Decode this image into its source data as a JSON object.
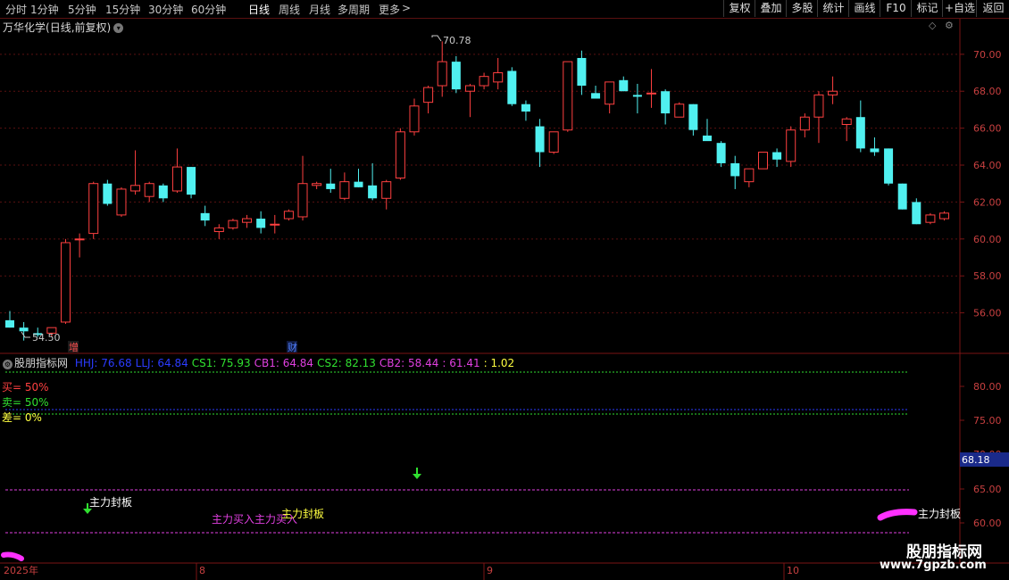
{
  "toolbar": {
    "periods": [
      "分时",
      "1分钟",
      "5分钟",
      "15分钟",
      "30分钟",
      "60分钟",
      "日线",
      "周线",
      "月线",
      "多周期",
      "更多"
    ],
    "active_period": "日线",
    "more_arrow": ">",
    "buttons": [
      "复权",
      "叠加",
      "多股",
      "统计",
      "画线",
      "F10",
      "标记",
      "+自选",
      "返回"
    ]
  },
  "stock": {
    "name": "万华化学",
    "period_label": "(日线,前复权)"
  },
  "price_axis": {
    "ticks": [
      "70.00",
      "68.00",
      "66.00",
      "64.00",
      "62.00",
      "60.00",
      "58.00",
      "56.00"
    ],
    "min": 54.0,
    "max": 71.2
  },
  "annotations": {
    "high_label": "70.78",
    "low_label": "54.50",
    "marker_zeng": "增",
    "marker_cai": "财"
  },
  "indicator": {
    "name": "股朋指标网",
    "values": [
      {
        "label": "HHJ: 76.68",
        "color": "#2b3cff"
      },
      {
        "label": "LLJ: 64.84",
        "color": "#2b3cff"
      },
      {
        "label": "CS1: 75.93",
        "color": "#30e030"
      },
      {
        "label": "CB1: 64.84",
        "color": "#e040e0"
      },
      {
        "label": "CS2: 82.13",
        "color": "#30e030"
      },
      {
        "label": "CB2: 58.44",
        "color": "#e040e0"
      },
      {
        "label": ": 61.41",
        "color": "#e040e0"
      },
      {
        "label": ": 1.02",
        "color": "#ffff40"
      }
    ],
    "buy_label": "买= 50%",
    "sell_label": "卖= 50%",
    "diff_label": "差= 0%",
    "axis_ticks": [
      "80.00",
      "75.00",
      "70.00",
      "65.00",
      "60.00"
    ],
    "current_value": "68.18",
    "signal_text_1": "主力封板",
    "signal_text_2": "主力买入主力买入",
    "signal_text_3": "主力封板",
    "signal_text_4": "主力封板"
  },
  "date_axis": {
    "labels": [
      "2025年",
      "8",
      "9",
      "10"
    ]
  },
  "watermark": {
    "name": "股朋指标网",
    "url": "www.7gpzb.com"
  },
  "colors": {
    "up": "#ff4040",
    "down": "#50f0f0",
    "frame": "#7a1515",
    "grid": "#5a1010"
  },
  "chart_data": {
    "type": "candlestick",
    "candles": [
      {
        "o": 55.6,
        "h": 56.1,
        "l": 55.2,
        "c": 55.2
      },
      {
        "o": 55.2,
        "h": 55.5,
        "l": 54.5,
        "c": 55.0
      },
      {
        "o": 54.9,
        "h": 55.2,
        "l": 54.7,
        "c": 54.8
      },
      {
        "o": 54.9,
        "h": 55.2,
        "l": 54.7,
        "c": 55.2
      },
      {
        "o": 55.5,
        "h": 60.0,
        "l": 55.4,
        "c": 59.8
      },
      {
        "o": 60.0,
        "h": 60.3,
        "l": 59.0,
        "c": 60.0
      },
      {
        "o": 60.3,
        "h": 63.1,
        "l": 60.0,
        "c": 63.0
      },
      {
        "o": 63.0,
        "h": 63.2,
        "l": 61.8,
        "c": 61.9
      },
      {
        "o": 61.3,
        "h": 62.8,
        "l": 61.2,
        "c": 62.7
      },
      {
        "o": 62.6,
        "h": 64.8,
        "l": 62.4,
        "c": 62.9
      },
      {
        "o": 62.3,
        "h": 63.1,
        "l": 62.0,
        "c": 63.0
      },
      {
        "o": 62.9,
        "h": 63.0,
        "l": 62.0,
        "c": 62.2
      },
      {
        "o": 62.6,
        "h": 64.9,
        "l": 62.5,
        "c": 63.9
      },
      {
        "o": 63.9,
        "h": 63.9,
        "l": 62.2,
        "c": 62.4
      },
      {
        "o": 61.4,
        "h": 61.8,
        "l": 60.7,
        "c": 61.0
      },
      {
        "o": 60.4,
        "h": 60.8,
        "l": 60.0,
        "c": 60.6
      },
      {
        "o": 60.6,
        "h": 61.1,
        "l": 60.5,
        "c": 61.0
      },
      {
        "o": 60.9,
        "h": 61.3,
        "l": 60.6,
        "c": 61.1
      },
      {
        "o": 61.1,
        "h": 61.5,
        "l": 60.3,
        "c": 60.6
      },
      {
        "o": 60.8,
        "h": 61.3,
        "l": 60.3,
        "c": 60.8
      },
      {
        "o": 61.1,
        "h": 61.6,
        "l": 61.0,
        "c": 61.5
      },
      {
        "o": 61.2,
        "h": 64.5,
        "l": 61.0,
        "c": 63.0
      },
      {
        "o": 62.9,
        "h": 63.1,
        "l": 62.7,
        "c": 63.0
      },
      {
        "o": 63.0,
        "h": 63.8,
        "l": 62.5,
        "c": 62.7
      },
      {
        "o": 62.2,
        "h": 63.6,
        "l": 62.1,
        "c": 63.1
      },
      {
        "o": 63.1,
        "h": 63.8,
        "l": 62.8,
        "c": 62.8
      },
      {
        "o": 62.9,
        "h": 64.1,
        "l": 62.1,
        "c": 62.2
      },
      {
        "o": 62.2,
        "h": 63.2,
        "l": 61.6,
        "c": 63.1
      },
      {
        "o": 63.3,
        "h": 66.0,
        "l": 63.2,
        "c": 65.8
      },
      {
        "o": 65.8,
        "h": 67.6,
        "l": 65.6,
        "c": 67.2
      },
      {
        "o": 67.4,
        "h": 68.3,
        "l": 66.8,
        "c": 68.2
      },
      {
        "o": 68.3,
        "h": 70.7,
        "l": 67.7,
        "c": 69.6
      },
      {
        "o": 69.6,
        "h": 69.9,
        "l": 67.9,
        "c": 68.1
      },
      {
        "o": 68.0,
        "h": 68.4,
        "l": 66.6,
        "c": 68.3
      },
      {
        "o": 68.3,
        "h": 69.0,
        "l": 68.1,
        "c": 68.8
      },
      {
        "o": 68.5,
        "h": 69.8,
        "l": 68.1,
        "c": 69.0
      },
      {
        "o": 69.1,
        "h": 69.3,
        "l": 67.2,
        "c": 67.3
      },
      {
        "o": 67.3,
        "h": 67.5,
        "l": 66.4,
        "c": 66.9
      },
      {
        "o": 66.1,
        "h": 66.5,
        "l": 63.9,
        "c": 64.7
      },
      {
        "o": 64.7,
        "h": 65.8,
        "l": 64.6,
        "c": 65.8
      },
      {
        "o": 65.9,
        "h": 69.6,
        "l": 65.8,
        "c": 69.6
      },
      {
        "o": 69.8,
        "h": 70.2,
        "l": 67.8,
        "c": 68.3
      },
      {
        "o": 67.9,
        "h": 68.3,
        "l": 67.6,
        "c": 67.6
      },
      {
        "o": 67.3,
        "h": 68.4,
        "l": 66.8,
        "c": 68.5
      },
      {
        "o": 68.6,
        "h": 68.8,
        "l": 68.0,
        "c": 68.0
      },
      {
        "o": 67.8,
        "h": 68.4,
        "l": 66.8,
        "c": 67.7
      },
      {
        "o": 67.9,
        "h": 69.2,
        "l": 67.1,
        "c": 67.9
      },
      {
        "o": 68.0,
        "h": 68.1,
        "l": 66.2,
        "c": 66.8
      },
      {
        "o": 66.6,
        "h": 67.4,
        "l": 66.6,
        "c": 67.3
      },
      {
        "o": 67.3,
        "h": 67.3,
        "l": 65.6,
        "c": 65.9
      },
      {
        "o": 65.6,
        "h": 66.5,
        "l": 65.4,
        "c": 65.3
      },
      {
        "o": 65.2,
        "h": 65.3,
        "l": 63.9,
        "c": 64.1
      },
      {
        "o": 64.1,
        "h": 64.5,
        "l": 62.7,
        "c": 63.4
      },
      {
        "o": 63.1,
        "h": 63.8,
        "l": 62.8,
        "c": 63.8
      },
      {
        "o": 63.8,
        "h": 64.7,
        "l": 63.8,
        "c": 64.7
      },
      {
        "o": 64.7,
        "h": 64.9,
        "l": 63.9,
        "c": 64.3
      },
      {
        "o": 64.2,
        "h": 66.1,
        "l": 63.9,
        "c": 65.9
      },
      {
        "o": 65.9,
        "h": 66.8,
        "l": 65.5,
        "c": 66.6
      },
      {
        "o": 66.6,
        "h": 68.0,
        "l": 65.2,
        "c": 67.8
      },
      {
        "o": 67.8,
        "h": 68.8,
        "l": 67.3,
        "c": 68.0
      },
      {
        "o": 66.2,
        "h": 66.6,
        "l": 65.3,
        "c": 66.5
      },
      {
        "o": 66.6,
        "h": 67.5,
        "l": 64.7,
        "c": 64.9
      },
      {
        "o": 64.9,
        "h": 65.5,
        "l": 64.5,
        "c": 64.7
      },
      {
        "o": 64.9,
        "h": 64.9,
        "l": 62.9,
        "c": 63.0
      },
      {
        "o": 63.0,
        "h": 63.0,
        "l": 61.6,
        "c": 61.6
      },
      {
        "o": 62.0,
        "h": 62.2,
        "l": 60.8,
        "c": 60.8
      },
      {
        "o": 60.9,
        "h": 61.4,
        "l": 60.8,
        "c": 61.3
      },
      {
        "o": 61.1,
        "h": 61.5,
        "l": 61.0,
        "c": 61.4
      }
    ]
  }
}
